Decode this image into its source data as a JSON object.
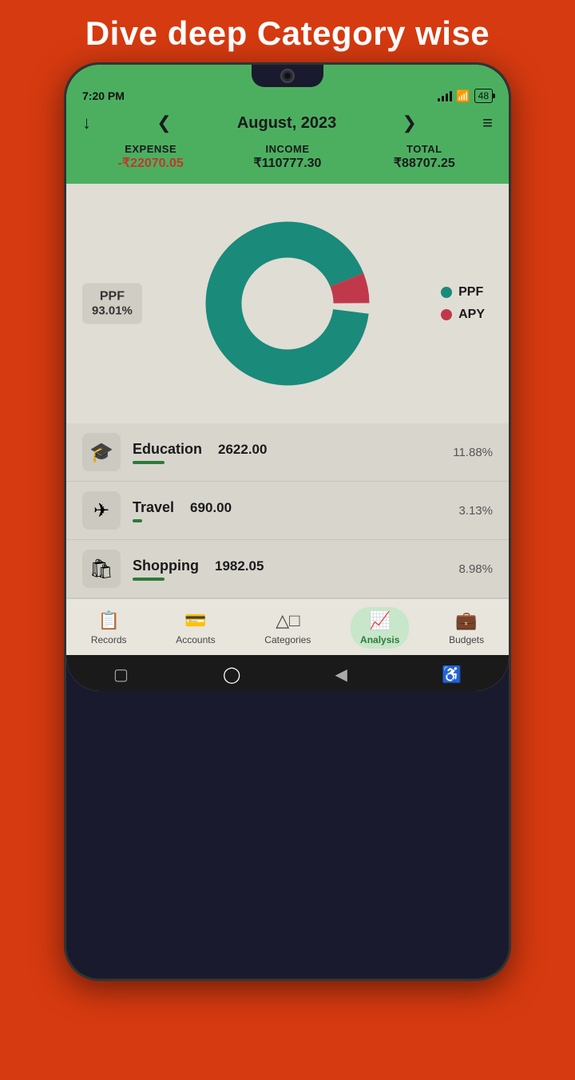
{
  "page": {
    "title": "Dive deep Category wise"
  },
  "status_bar": {
    "time": "7:20 PM",
    "battery": "48"
  },
  "header": {
    "month": "August, 2023",
    "expense_label": "EXPENSE",
    "income_label": "INCOME",
    "total_label": "TOTAL",
    "expense_value": "-₹22070.05",
    "income_value": "₹110777.30",
    "total_value": "₹88707.25"
  },
  "chart": {
    "ppf_pct": 93.01,
    "apy_pct": 6.99,
    "ppf_color": "#1a8a7a",
    "apy_color": "#c0394b",
    "label_name": "PPF",
    "label_pct": "93.01%",
    "legend": [
      {
        "name": "PPF",
        "color": "#1a8a7a"
      },
      {
        "name": "APY",
        "color": "#c0394b"
      }
    ]
  },
  "categories": [
    {
      "name": "Education",
      "amount": "2622.00",
      "pct": "11.88%",
      "icon": "🎓",
      "bar_width": "long"
    },
    {
      "name": "Travel",
      "amount": "690.00",
      "pct": "3.13%",
      "icon": "✈",
      "bar_width": "short"
    },
    {
      "name": "Shopping",
      "amount": "1982.05",
      "pct": "8.98%",
      "icon": "🛍",
      "bar_width": "long"
    }
  ],
  "bottom_nav": [
    {
      "label": "Records",
      "icon": "📋",
      "active": false
    },
    {
      "label": "Accounts",
      "icon": "💳",
      "active": false
    },
    {
      "label": "Categories",
      "icon": "⬡",
      "active": false
    },
    {
      "label": "Analysis",
      "icon": "📈",
      "active": true
    },
    {
      "label": "Budgets",
      "icon": "💼",
      "active": false
    }
  ],
  "home_buttons": [
    "⬜",
    "⬤",
    "◀",
    "♿"
  ]
}
